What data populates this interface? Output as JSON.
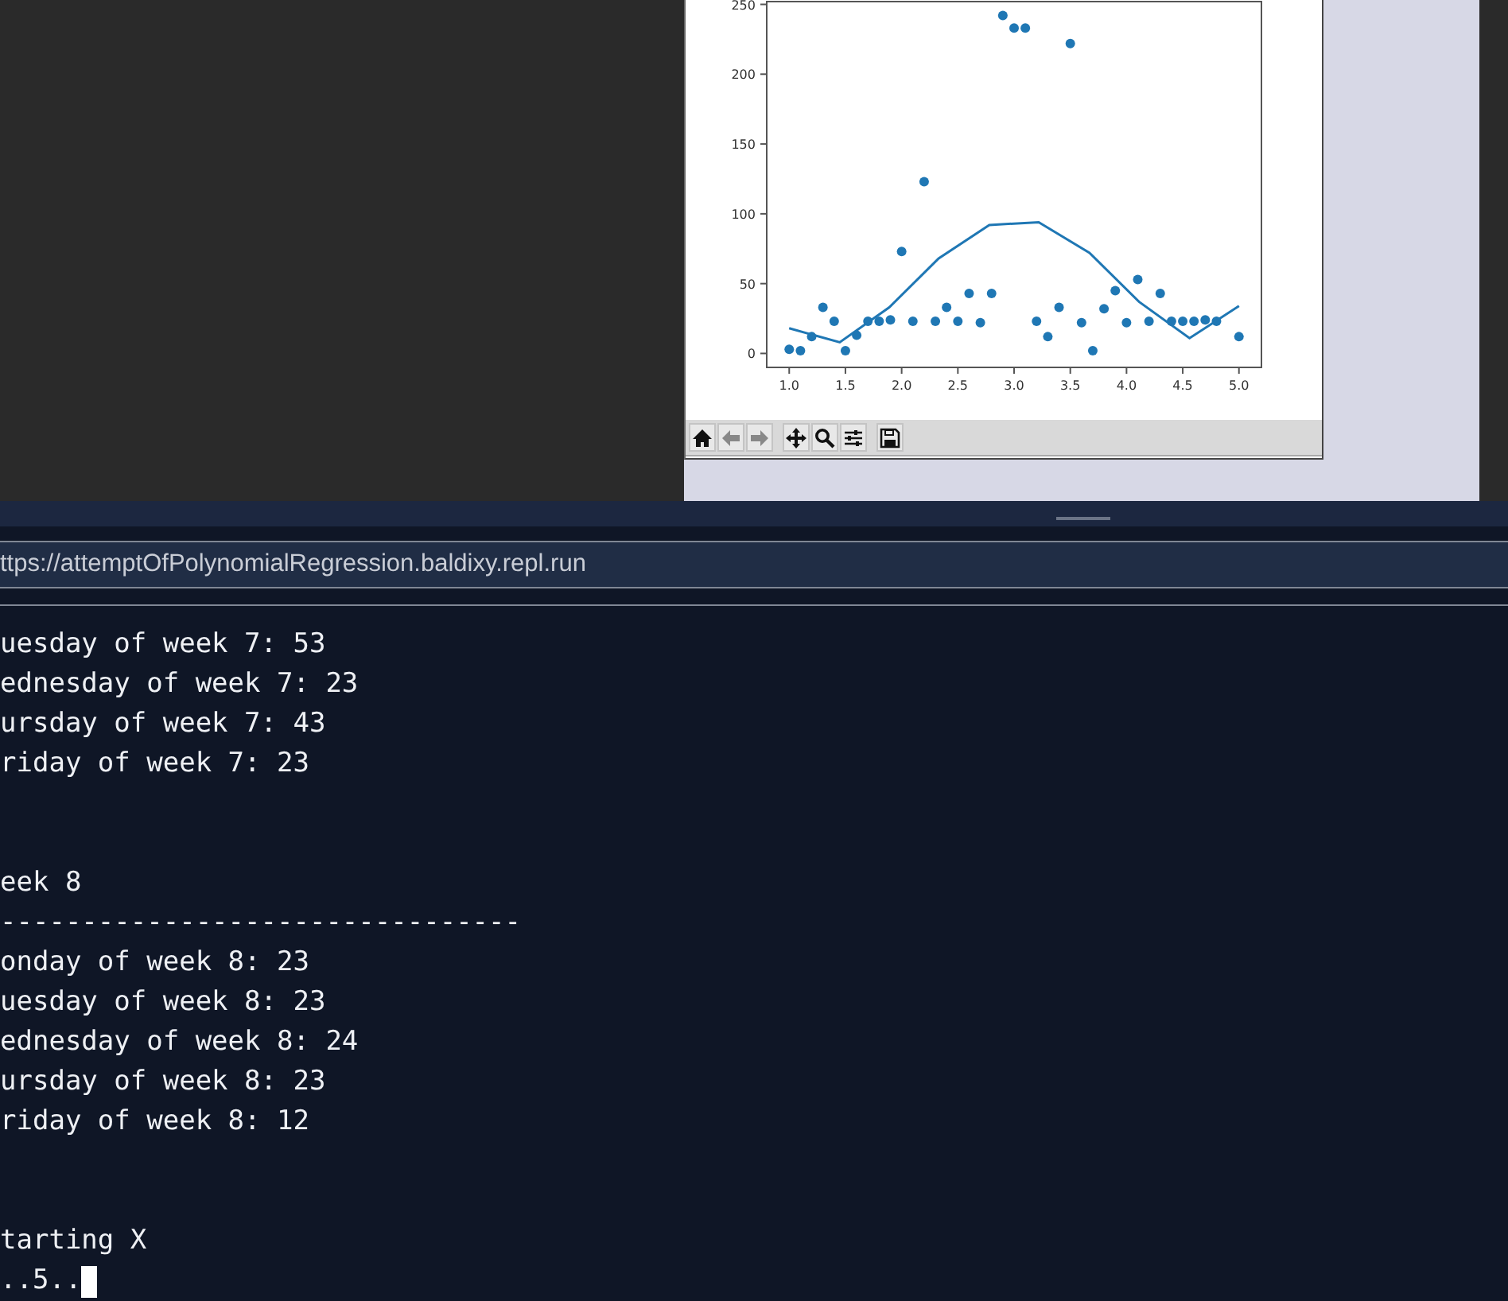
{
  "figure": {
    "chart_data": {
      "type": "scatter",
      "x": [
        1.0,
        1.1,
        1.2,
        1.3,
        1.4,
        1.5,
        1.6,
        1.7,
        1.8,
        1.9,
        2.0,
        2.1,
        2.2,
        2.3,
        2.4,
        2.5,
        2.6,
        2.7,
        2.8,
        2.9,
        3.0,
        3.1,
        3.2,
        3.3,
        3.4,
        3.5,
        3.6,
        3.7,
        3.8,
        3.9,
        4.0,
        4.1,
        4.2,
        4.3,
        4.4,
        4.5,
        4.6,
        4.7,
        4.8,
        5.0
      ],
      "xlim": [
        0.8,
        5.2
      ],
      "ylim": [
        -10,
        252
      ],
      "xticks": [
        {
          "value": 1.0,
          "label": "1.0"
        },
        {
          "value": 1.5,
          "label": "1.5"
        },
        {
          "value": 2.0,
          "label": "2.0"
        },
        {
          "value": 2.5,
          "label": "2.5"
        },
        {
          "value": 3.0,
          "label": "3.0"
        },
        {
          "value": 3.5,
          "label": "3.5"
        },
        {
          "value": 4.0,
          "label": "4.0"
        },
        {
          "value": 4.5,
          "label": "4.5"
        },
        {
          "value": 5.0,
          "label": "5.0"
        }
      ],
      "yticks": [
        0,
        50,
        100,
        150,
        200,
        250
      ],
      "series": [
        {
          "type": "scatter",
          "color": "#1f77b4",
          "values": [
            3,
            2,
            12,
            33,
            23,
            2,
            13,
            23,
            23,
            24,
            73,
            23,
            123,
            23,
            33,
            23,
            43,
            22,
            43,
            242,
            233,
            233,
            23,
            12,
            33,
            222,
            22,
            2,
            32,
            45,
            22,
            53,
            23,
            43,
            23,
            23,
            23,
            24,
            23,
            12
          ]
        },
        {
          "type": "line",
          "color": "#1f77b4",
          "x": [
            1.0,
            1.45,
            1.89,
            2.33,
            2.78,
            3.22,
            3.67,
            4.11,
            4.56,
            5.0
          ],
          "values": [
            18,
            8,
            33,
            68,
            92,
            94,
            72,
            37,
            11,
            34
          ]
        }
      ]
    }
  },
  "address_bar": {
    "url": "ttps://attemptOfPolynomialRegression.baldixy.repl.run"
  },
  "console": {
    "blocks": [
      [
        "uesday of week 7: 53",
        "ednesday of week 7: 23",
        "ursday of week 7: 43",
        "riday of week 7: 23"
      ],
      [
        "eek 8",
        "--------------------------------",
        "onday of week 8: 23",
        "uesday of week 8: 23",
        "ednesday of week 8: 24",
        "ursday of week 8: 23",
        "riday of week 8: 12"
      ],
      [
        "tarting X",
        "..5.."
      ]
    ]
  }
}
